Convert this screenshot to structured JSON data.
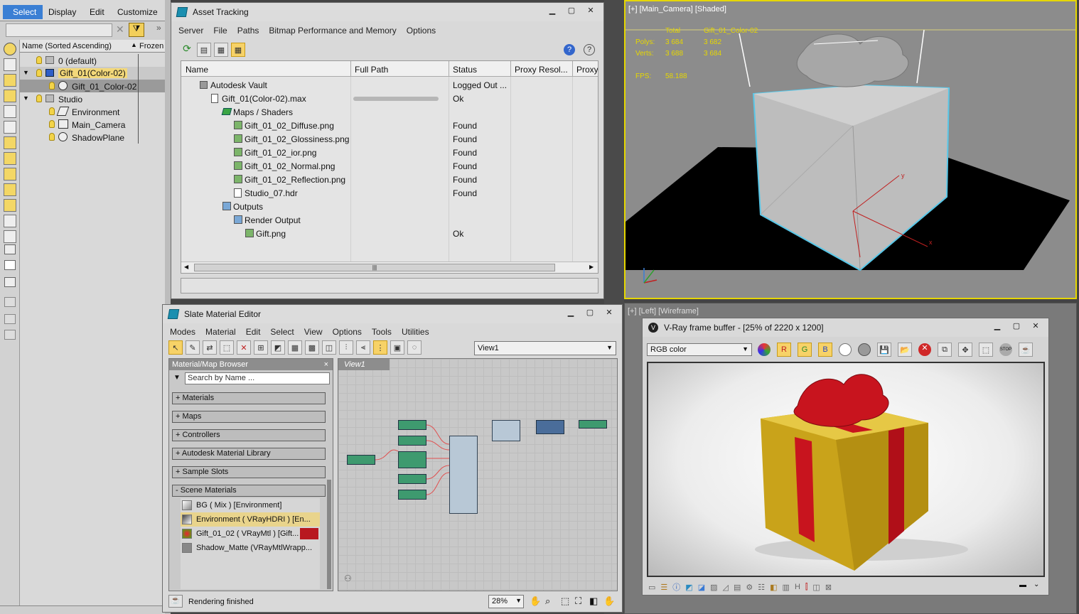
{
  "main_menu": {
    "select": "Select",
    "display": "Display",
    "edit": "Edit",
    "customize": "Customize"
  },
  "scene_explorer": {
    "col_name": "Name (Sorted Ascending)",
    "col_frozen": "Frozen",
    "items": [
      {
        "label": "0 (default)"
      },
      {
        "label": "Gift_01(Color-02)"
      },
      {
        "label": "Gift_01_Color-02"
      },
      {
        "label": "Studio"
      },
      {
        "label": "Environment"
      },
      {
        "label": "Main_Camera"
      },
      {
        "label": "ShadowPlane"
      }
    ]
  },
  "asset_tracking": {
    "title": "Asset Tracking",
    "menu": [
      "Server",
      "File",
      "Paths",
      "Bitmap Performance and Memory",
      "Options"
    ],
    "columns": [
      "Name",
      "Full Path",
      "Status",
      "Proxy Resol...",
      "Proxy"
    ],
    "rows": [
      {
        "name": "Autodesk Vault",
        "status": "Logged Out ..."
      },
      {
        "name": "Gift_01(Color-02).max",
        "status": "Ok"
      },
      {
        "name": "Maps / Shaders",
        "status": ""
      },
      {
        "name": "Gift_01_02_Diffuse.png",
        "status": "Found"
      },
      {
        "name": "Gift_01_02_Glossiness.png",
        "status": "Found"
      },
      {
        "name": "Gift_01_02_ior.png",
        "status": "Found"
      },
      {
        "name": "Gift_01_02_Normal.png",
        "status": "Found"
      },
      {
        "name": "Gift_01_02_Reflection.png",
        "status": "Found"
      },
      {
        "name": "Studio_07.hdr",
        "status": "Found"
      },
      {
        "name": "Outputs",
        "status": ""
      },
      {
        "name": "Render Output",
        "status": ""
      },
      {
        "name": "Gift.png",
        "status": "Ok"
      }
    ]
  },
  "viewport_top": {
    "label": "[+] [Main_Camera] [Shaded]",
    "stats_hdr_total": "Total",
    "stats_hdr_obj": "Gift_01_Color-02",
    "polys_label": "Polys:",
    "polys_total": "3 684",
    "polys_obj": "3 682",
    "verts_label": "Verts:",
    "verts_total": "3 688",
    "verts_obj": "3 684",
    "fps_label": "FPS:",
    "fps_value": "58.188"
  },
  "viewport_bottom": {
    "label": "[+] [Left] [Wireframe]"
  },
  "slate": {
    "title": "Slate Material Editor",
    "menu": [
      "Modes",
      "Material",
      "Edit",
      "Select",
      "View",
      "Options",
      "Tools",
      "Utilities"
    ],
    "view_select": "View1",
    "browser_title": "Material/Map Browser",
    "search_placeholder": "Search by Name ...",
    "sections": [
      "+ Materials",
      "+ Maps",
      "+ Controllers",
      "+ Autodesk Material Library",
      "+ Sample Slots",
      "- Scene Materials"
    ],
    "scene_materials": [
      "BG  ( Mix )  [Environment]",
      "Environment  ( VRayHDRI )  [En...",
      "Gift_01_02  ( VRayMtl )  [Gift...",
      "Shadow_Matte  (VRayMtlWrapp..."
    ],
    "view_tab": "View1",
    "status": "Rendering finished",
    "zoom": "28%"
  },
  "vfb": {
    "title": "V-Ray frame buffer - [25% of 2220 x 1200]",
    "channel": "RGB color"
  },
  "colors": {
    "accent_yellow": "#e6d700",
    "viewport_grey": "#8c8c8c",
    "ribbon_red": "#c8141e",
    "gold": "#d9b21c"
  }
}
